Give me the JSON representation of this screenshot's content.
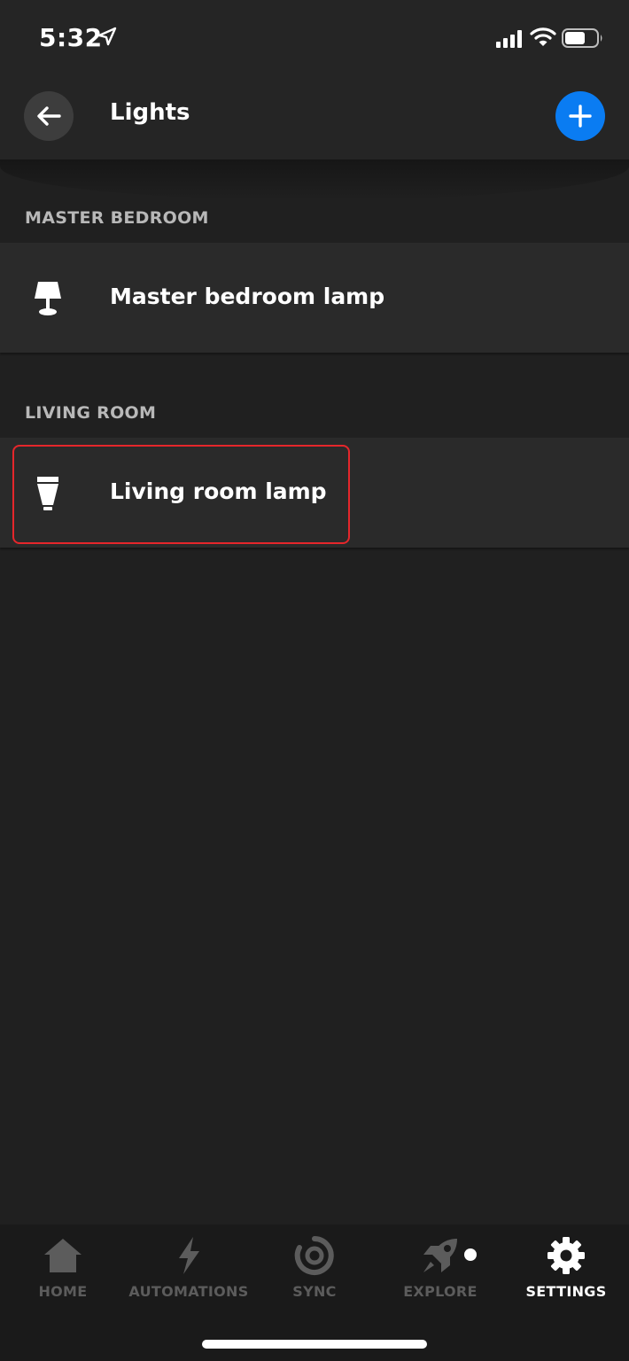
{
  "status_bar": {
    "time": "5:32"
  },
  "header": {
    "title": "Lights"
  },
  "sections": [
    {
      "title": "MASTER BEDROOM",
      "lights": [
        {
          "label": "Master bedroom lamp",
          "icon": "table-lamp-icon"
        }
      ]
    },
    {
      "title": "LIVING ROOM",
      "lights": [
        {
          "label": "Living room lamp",
          "icon": "bulb-icon"
        }
      ]
    }
  ],
  "tab_bar": {
    "tabs": [
      {
        "label": "HOME",
        "icon": "home-icon",
        "active": false
      },
      {
        "label": "AUTOMATIONS",
        "icon": "lightning-icon",
        "active": false
      },
      {
        "label": "SYNC",
        "icon": "sync-icon",
        "active": false
      },
      {
        "label": "EXPLORE",
        "icon": "rocket-icon",
        "active": false
      },
      {
        "label": "SETTINGS",
        "icon": "gear-icon",
        "active": true
      }
    ]
  },
  "colors": {
    "background": "#202020",
    "header": "#252525",
    "row": "#2a2a2a",
    "accent": "#0a7cf2",
    "highlight": "#e5262b",
    "inactive_tab": "#5c5c5c"
  }
}
